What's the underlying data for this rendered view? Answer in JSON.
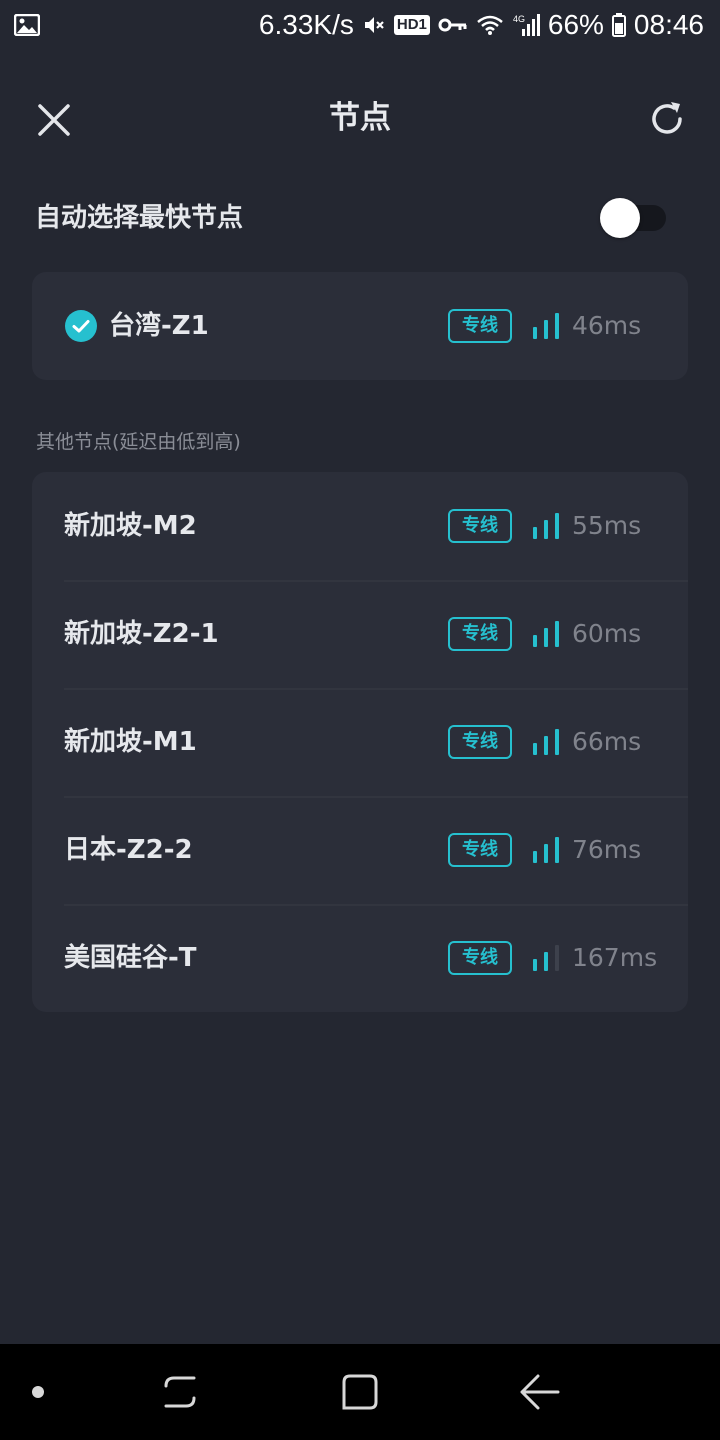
{
  "status_bar": {
    "net_speed": "6.33K/s",
    "battery": "66%",
    "time": "08:46",
    "hd_label": "HD1",
    "network_label": "4G"
  },
  "header": {
    "title": "节点",
    "close_icon": "close-icon",
    "refresh_icon": "refresh-icon"
  },
  "auto_select": {
    "label": "自动选择最快节点",
    "enabled": false
  },
  "selected_node": {
    "name": "台湾-Z1",
    "badge": "专线",
    "latency": "46ms",
    "signal_bars": 3
  },
  "others": {
    "section_label": "其他节点(延迟由低到高)",
    "nodes": [
      {
        "name": "新加坡-M2",
        "badge": "专线",
        "latency": "55ms",
        "signal_bars": 3
      },
      {
        "name": "新加坡-Z2-1",
        "badge": "专线",
        "latency": "60ms",
        "signal_bars": 3
      },
      {
        "name": "新加坡-M1",
        "badge": "专线",
        "latency": "66ms",
        "signal_bars": 3
      },
      {
        "name": "日本-Z2-2",
        "badge": "专线",
        "latency": "76ms",
        "signal_bars": 3
      },
      {
        "name": "美国硅谷-T",
        "badge": "专线",
        "latency": "167ms",
        "signal_bars": 2
      }
    ]
  },
  "colors": {
    "background": "#242731",
    "card": "#2b2e39",
    "accent": "#26c0cf",
    "signal_inactive": "#3d414c"
  }
}
